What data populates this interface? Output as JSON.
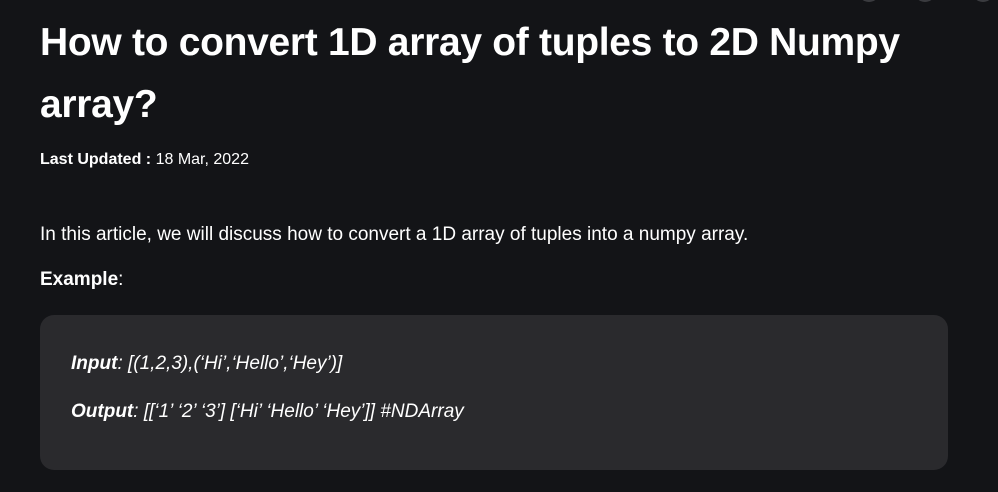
{
  "article": {
    "title": "How to convert 1D array of tuples to 2D Numpy array?",
    "meta_label": "Last Updated :",
    "meta_date": "18 Mar, 2022",
    "intro": "In this article, we will discuss how to convert a 1D array of tuples into a numpy array.",
    "example_label": "Example",
    "example_colon": ":"
  },
  "example": {
    "input_label": "Input",
    "input_value": ": [(1,2,3),(‘Hi’,‘Hello’,‘Hey’)]",
    "output_label": "Output",
    "output_value": ": [[‘1’ ‘2’ ‘3’] [‘Hi’ ‘Hello’ ‘Hey’]] #NDArray"
  },
  "colors": {
    "background": "#131417",
    "code_box": "#2a2a2d",
    "text": "#ffffff"
  }
}
